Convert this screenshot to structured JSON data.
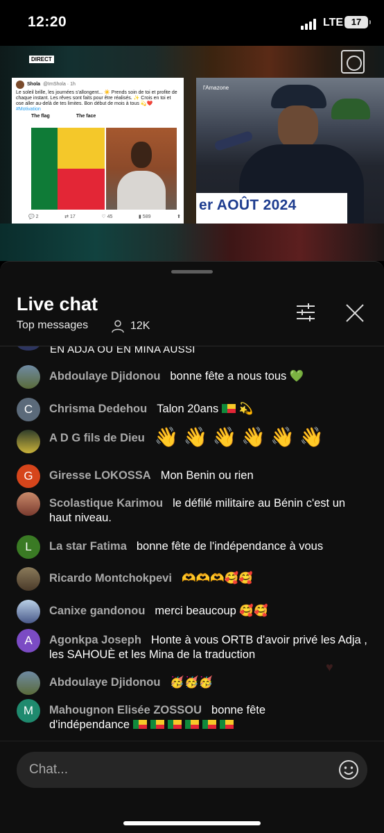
{
  "status_bar": {
    "time": "12:20",
    "network": "LTE",
    "battery": "17"
  },
  "video": {
    "badge": "DIRECT",
    "tweet": {
      "name": "Shola",
      "handle": "@ImShola · 1h",
      "text": "Le soleil brille, les journées s'allongent... ☀️ Prends soin de toi et profite de chaque instant. Les rêves sont faits pour être réalisés. ✨ Crois en toi et ose aller au-delà de tes limites. Bon début de mois à tous 💫❤️",
      "hashtag": "#Motivation",
      "caption_left": "The flag",
      "caption_right": "The face",
      "replies": "2",
      "retweets": "17",
      "likes": "45",
      "views": "589"
    },
    "banner_small": "l'Amazone",
    "banner": "er AOÛT 2024"
  },
  "chat": {
    "title": "Live chat",
    "mode": "Top messages",
    "viewers": "12K",
    "partial_message": "EN ADJA OU EN MINA AUSSI",
    "placeholder": "Chat...",
    "messages": [
      {
        "author": "Abdoulaye Djidonou",
        "text": "bonne fête a nous tous 💚"
      },
      {
        "author": "Chrisma Dedehou",
        "initial": "C",
        "text": "Talon 20ans",
        "tail": "💫"
      },
      {
        "author": "A D G fils de Dieu",
        "text": "👋👋👋👋👋👋"
      },
      {
        "author": "Giresse LOKOSSA",
        "initial": "G",
        "text": "Mon Benin ou rien"
      },
      {
        "author": "Scolastique Karimou",
        "text": "le défilé militaire au Bénin c'est un haut niveau."
      },
      {
        "author": "La star Fatima",
        "initial": "L",
        "text": "bonne fête de l'indépendance à vous"
      },
      {
        "author": "Ricardo Montchokpevi",
        "text": "🫶🫶🫶🥰🥰"
      },
      {
        "author": "Canixe gandonou",
        "text": "merci beaucoup 🥰🥰"
      },
      {
        "author": "Agonkpa Joseph",
        "initial": "A",
        "text": "Honte à vous ORTB d'avoir privé les Adja , les SAHOUÈ et les Mina de la traduction"
      },
      {
        "author": "Abdoulaye Djidonou",
        "text": "🥳🥳🥳"
      },
      {
        "author": "Mahougnon Elisée ZOSSOU",
        "initial": "M",
        "text": "bonne fête d'indépendance"
      }
    ]
  },
  "colors": {
    "background": "#0f0f0f",
    "author": "#aaaaaa",
    "like": "#ff2e38",
    "input": "#262626"
  }
}
